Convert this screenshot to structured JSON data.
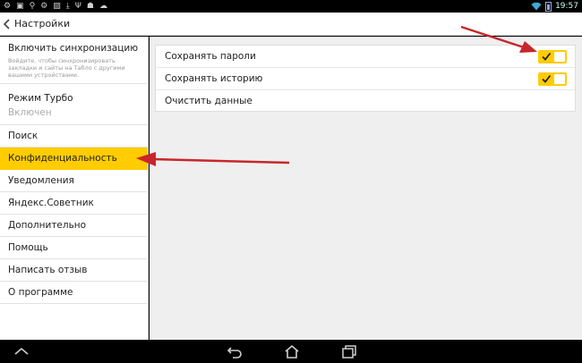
{
  "status_bar": {
    "time": "19:57"
  },
  "app_bar": {
    "title": "Настройки"
  },
  "sidebar": {
    "sync": {
      "label": "Включить синхронизацию",
      "description": "Войдите, чтобы синхронизировать закладки и сайты на Табло с другими вашими устройствами."
    },
    "turbo": {
      "label": "Режим Турбо",
      "value": "Включен"
    },
    "items": [
      {
        "label": "Поиск"
      },
      {
        "label": "Конфиденциальность",
        "active": true
      },
      {
        "label": "Уведомления"
      },
      {
        "label": "Яндекс.Советник"
      },
      {
        "label": "Дополнительно"
      },
      {
        "label": "Помощь"
      },
      {
        "label": "Написать отзыв"
      },
      {
        "label": "О программе"
      }
    ]
  },
  "privacy": {
    "save_passwords": {
      "label": "Сохранять пароли",
      "checked": true
    },
    "save_history": {
      "label": "Сохранять историю",
      "checked": true
    },
    "clear_data": {
      "label": "Очистить данные"
    }
  },
  "colors": {
    "accent": "#ffcc00",
    "annotation_arrow": "#c8262b"
  },
  "icons": {
    "status_left": [
      "android-debug-icon",
      "sd-card-icon",
      "usb-icon",
      "settings-icon",
      "image-icon",
      "download-icon",
      "usb-icon",
      "android-icon",
      "cloud-icon"
    ],
    "status_right": [
      "wifi-icon",
      "battery-icon"
    ],
    "nav": [
      "collapse-icon",
      "back-icon",
      "home-icon",
      "recent-apps-icon"
    ]
  }
}
